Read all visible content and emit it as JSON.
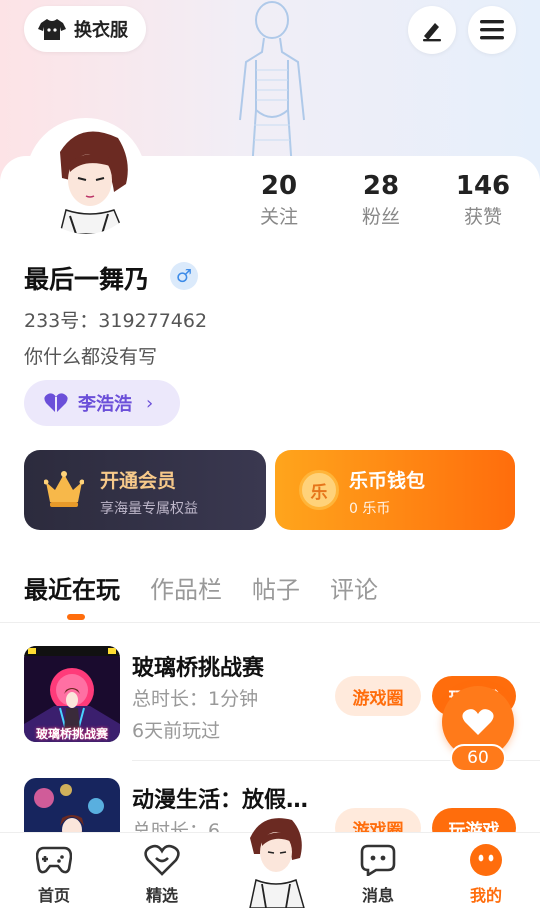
{
  "header": {
    "dressup_label": "换衣服",
    "edit_icon": "pen-icon",
    "menu_icon": "hamburger-icon"
  },
  "profile": {
    "stats": [
      {
        "value": "20",
        "label": "关注"
      },
      {
        "value": "28",
        "label": "粉丝"
      },
      {
        "value": "146",
        "label": "获赞"
      }
    ],
    "username": "最后一舞乃",
    "gender_symbol": "♂",
    "uid": "233号：319277462",
    "bio": "你什么都没有写",
    "tag_label": "李浩浩"
  },
  "banners": {
    "vip": {
      "title": "开通会员",
      "subtitle": "享海量专属权益"
    },
    "wallet": {
      "title": "乐币钱包",
      "subtitle": "0 乐币",
      "coin_char": "乐"
    }
  },
  "tabs": [
    "最近在玩",
    "作品栏",
    "帖子",
    "评论"
  ],
  "games": [
    {
      "title": "玻璃桥挑战赛",
      "duration": "总时长：1分钟",
      "last_played": "6天前玩过",
      "thumb_caption": "玻璃桥挑战赛",
      "circle_label": "游戏圈",
      "play_label": "玩游戏"
    },
    {
      "title": "动漫生活：放假…",
      "duration": "总时长：6",
      "last_played": "",
      "thumb_caption": "",
      "circle_label": "游戏圈",
      "play_label": "玩游戏"
    }
  ],
  "fab": {
    "count": "60"
  },
  "nav": [
    {
      "label": "首页"
    },
    {
      "label": "精选"
    },
    {
      "label": "消息"
    },
    {
      "label": "我的"
    }
  ],
  "colors": {
    "accent": "#ff6d0c",
    "vip_dark": "#2c2b3d",
    "tag_purple": "#6b4fd9"
  }
}
